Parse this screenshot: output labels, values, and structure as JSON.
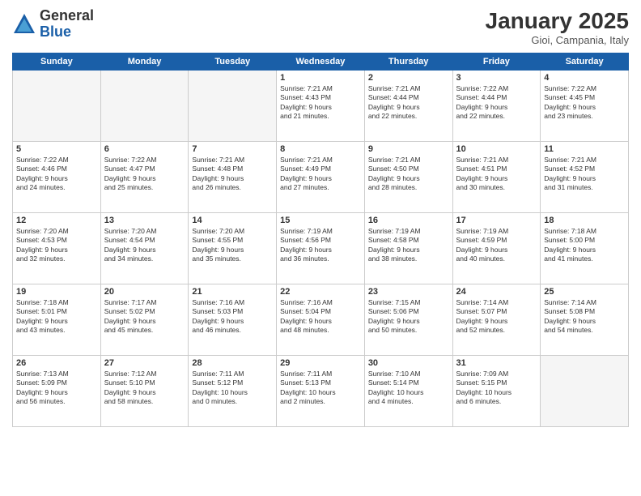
{
  "header": {
    "logo_general": "General",
    "logo_blue": "Blue",
    "month_title": "January 2025",
    "location": "Gioi, Campania, Italy"
  },
  "weekdays": [
    "Sunday",
    "Monday",
    "Tuesday",
    "Wednesday",
    "Thursday",
    "Friday",
    "Saturday"
  ],
  "weeks": [
    [
      {
        "day": "",
        "info": ""
      },
      {
        "day": "",
        "info": ""
      },
      {
        "day": "",
        "info": ""
      },
      {
        "day": "1",
        "info": "Sunrise: 7:21 AM\nSunset: 4:43 PM\nDaylight: 9 hours\nand 21 minutes."
      },
      {
        "day": "2",
        "info": "Sunrise: 7:21 AM\nSunset: 4:44 PM\nDaylight: 9 hours\nand 22 minutes."
      },
      {
        "day": "3",
        "info": "Sunrise: 7:22 AM\nSunset: 4:44 PM\nDaylight: 9 hours\nand 22 minutes."
      },
      {
        "day": "4",
        "info": "Sunrise: 7:22 AM\nSunset: 4:45 PM\nDaylight: 9 hours\nand 23 minutes."
      }
    ],
    [
      {
        "day": "5",
        "info": "Sunrise: 7:22 AM\nSunset: 4:46 PM\nDaylight: 9 hours\nand 24 minutes."
      },
      {
        "day": "6",
        "info": "Sunrise: 7:22 AM\nSunset: 4:47 PM\nDaylight: 9 hours\nand 25 minutes."
      },
      {
        "day": "7",
        "info": "Sunrise: 7:21 AM\nSunset: 4:48 PM\nDaylight: 9 hours\nand 26 minutes."
      },
      {
        "day": "8",
        "info": "Sunrise: 7:21 AM\nSunset: 4:49 PM\nDaylight: 9 hours\nand 27 minutes."
      },
      {
        "day": "9",
        "info": "Sunrise: 7:21 AM\nSunset: 4:50 PM\nDaylight: 9 hours\nand 28 minutes."
      },
      {
        "day": "10",
        "info": "Sunrise: 7:21 AM\nSunset: 4:51 PM\nDaylight: 9 hours\nand 30 minutes."
      },
      {
        "day": "11",
        "info": "Sunrise: 7:21 AM\nSunset: 4:52 PM\nDaylight: 9 hours\nand 31 minutes."
      }
    ],
    [
      {
        "day": "12",
        "info": "Sunrise: 7:20 AM\nSunset: 4:53 PM\nDaylight: 9 hours\nand 32 minutes."
      },
      {
        "day": "13",
        "info": "Sunrise: 7:20 AM\nSunset: 4:54 PM\nDaylight: 9 hours\nand 34 minutes."
      },
      {
        "day": "14",
        "info": "Sunrise: 7:20 AM\nSunset: 4:55 PM\nDaylight: 9 hours\nand 35 minutes."
      },
      {
        "day": "15",
        "info": "Sunrise: 7:19 AM\nSunset: 4:56 PM\nDaylight: 9 hours\nand 36 minutes."
      },
      {
        "day": "16",
        "info": "Sunrise: 7:19 AM\nSunset: 4:58 PM\nDaylight: 9 hours\nand 38 minutes."
      },
      {
        "day": "17",
        "info": "Sunrise: 7:19 AM\nSunset: 4:59 PM\nDaylight: 9 hours\nand 40 minutes."
      },
      {
        "day": "18",
        "info": "Sunrise: 7:18 AM\nSunset: 5:00 PM\nDaylight: 9 hours\nand 41 minutes."
      }
    ],
    [
      {
        "day": "19",
        "info": "Sunrise: 7:18 AM\nSunset: 5:01 PM\nDaylight: 9 hours\nand 43 minutes."
      },
      {
        "day": "20",
        "info": "Sunrise: 7:17 AM\nSunset: 5:02 PM\nDaylight: 9 hours\nand 45 minutes."
      },
      {
        "day": "21",
        "info": "Sunrise: 7:16 AM\nSunset: 5:03 PM\nDaylight: 9 hours\nand 46 minutes."
      },
      {
        "day": "22",
        "info": "Sunrise: 7:16 AM\nSunset: 5:04 PM\nDaylight: 9 hours\nand 48 minutes."
      },
      {
        "day": "23",
        "info": "Sunrise: 7:15 AM\nSunset: 5:06 PM\nDaylight: 9 hours\nand 50 minutes."
      },
      {
        "day": "24",
        "info": "Sunrise: 7:14 AM\nSunset: 5:07 PM\nDaylight: 9 hours\nand 52 minutes."
      },
      {
        "day": "25",
        "info": "Sunrise: 7:14 AM\nSunset: 5:08 PM\nDaylight: 9 hours\nand 54 minutes."
      }
    ],
    [
      {
        "day": "26",
        "info": "Sunrise: 7:13 AM\nSunset: 5:09 PM\nDaylight: 9 hours\nand 56 minutes."
      },
      {
        "day": "27",
        "info": "Sunrise: 7:12 AM\nSunset: 5:10 PM\nDaylight: 9 hours\nand 58 minutes."
      },
      {
        "day": "28",
        "info": "Sunrise: 7:11 AM\nSunset: 5:12 PM\nDaylight: 10 hours\nand 0 minutes."
      },
      {
        "day": "29",
        "info": "Sunrise: 7:11 AM\nSunset: 5:13 PM\nDaylight: 10 hours\nand 2 minutes."
      },
      {
        "day": "30",
        "info": "Sunrise: 7:10 AM\nSunset: 5:14 PM\nDaylight: 10 hours\nand 4 minutes."
      },
      {
        "day": "31",
        "info": "Sunrise: 7:09 AM\nSunset: 5:15 PM\nDaylight: 10 hours\nand 6 minutes."
      },
      {
        "day": "",
        "info": ""
      }
    ]
  ]
}
